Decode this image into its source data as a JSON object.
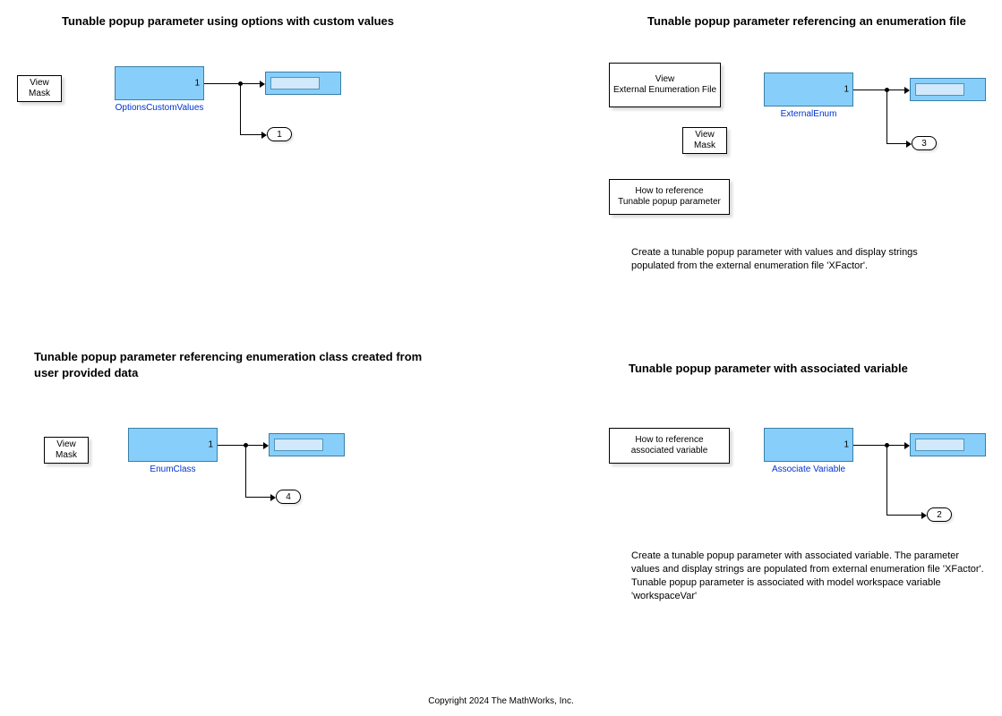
{
  "sections": {
    "s1": {
      "title": "Tunable popup parameter using options with custom values",
      "viewMask": "View\nMask",
      "blockLabel": "OptionsCustomValues",
      "port": "1",
      "outport": "1"
    },
    "s2": {
      "title": "Tunable popup parameter referencing an enumeration file",
      "viewEnum": "View\nExternal Enumeration File",
      "viewMask": "View\nMask",
      "howTo": "How to reference\nTunable popup parameter",
      "blockLabel": "ExternalEnum",
      "port": "1",
      "outport": "3",
      "desc": "Create a tunable popup parameter with values and display strings populated from the external enumeration file 'XFactor'."
    },
    "s3": {
      "title": "Tunable popup parameter referencing enumeration class created from user provided data",
      "viewMask": "View\nMask",
      "blockLabel": "EnumClass",
      "port": "1",
      "outport": "4"
    },
    "s4": {
      "title": "Tunable popup parameter with associated variable",
      "howTo": "How to reference\nassociated variable",
      "blockLabel": "Associate Variable",
      "port": "1",
      "outport": "2",
      "desc": "Create a tunable popup parameter with associated variable. The parameter values and display strings are populated from external enumeration file 'XFactor'. Tunable popup parameter is associated with model workspace variable 'workspaceVar'"
    }
  },
  "footer": "Copyright 2024 The MathWorks, Inc."
}
